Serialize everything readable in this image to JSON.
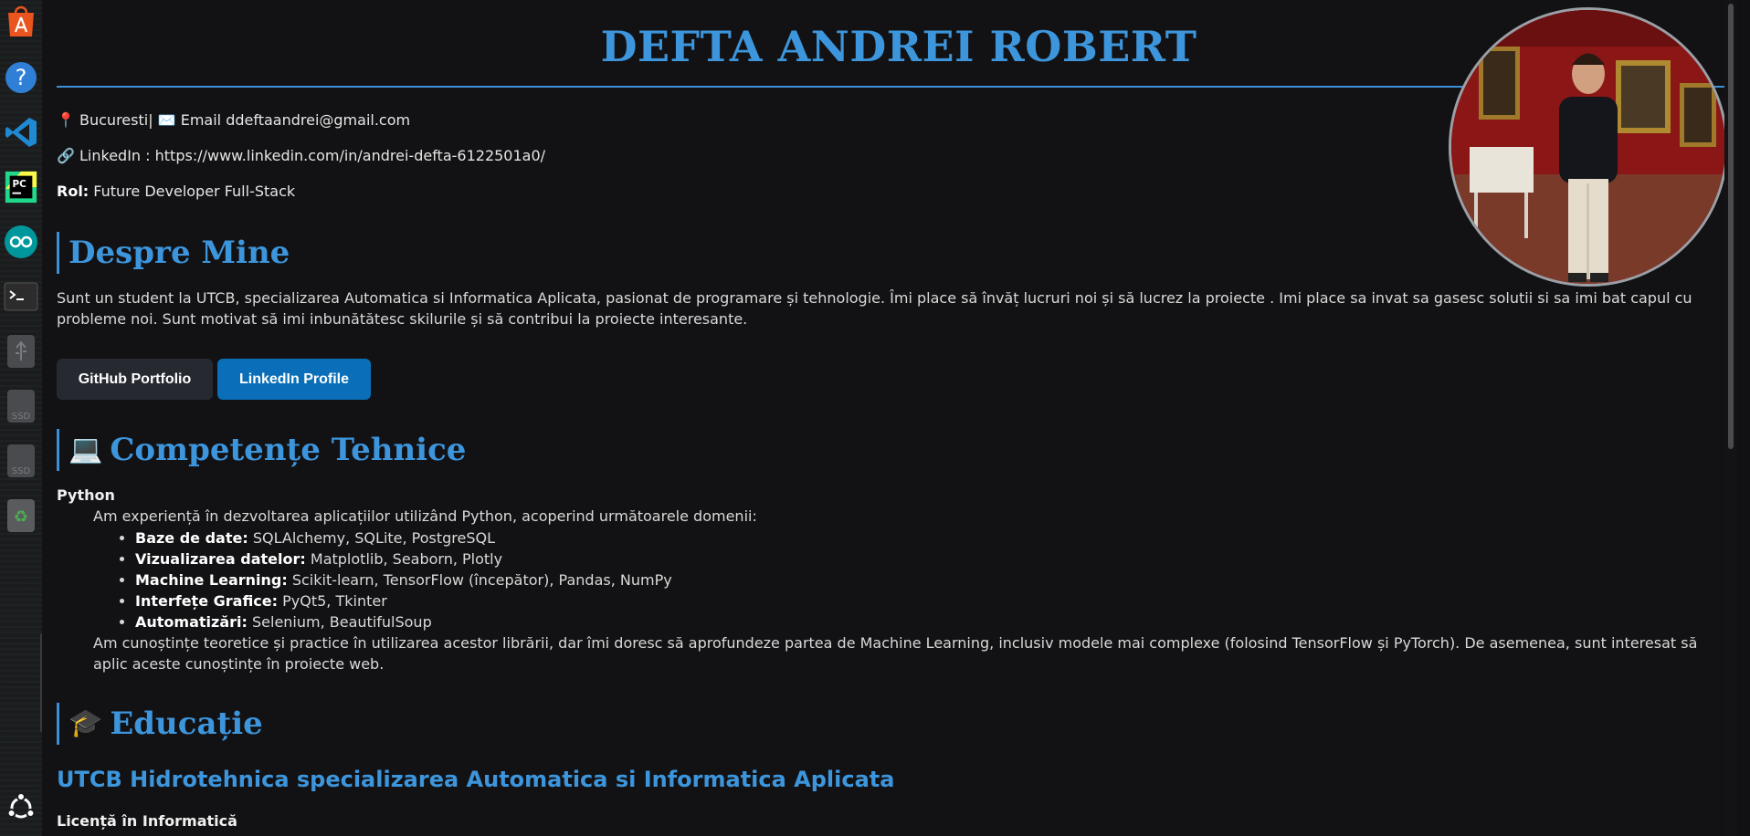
{
  "dock": {
    "items": [
      {
        "name": "app-store-icon"
      },
      {
        "name": "help-icon"
      },
      {
        "name": "vscode-icon"
      },
      {
        "name": "pycharm-icon"
      },
      {
        "name": "arduino-icon"
      },
      {
        "name": "terminal-icon"
      },
      {
        "name": "usb-drive-icon"
      },
      {
        "name": "ssd-drive-icon"
      },
      {
        "name": "ssd-drive-icon"
      },
      {
        "name": "trash-icon"
      },
      {
        "name": "ubuntu-apps-icon"
      }
    ],
    "ssd_label": "SSD",
    "pycharm_label": "PC"
  },
  "header": {
    "name": "DEFTA ANDREI ROBERT"
  },
  "contact": {
    "location_icon": "📍",
    "location": "Bucuresti",
    "separator": "|",
    "email_icon": "✉️",
    "email_label": "Email",
    "email": "ddeftaandrei@gmail.com",
    "link_icon": "🔗",
    "linkedin_label": "LinkedIn :",
    "linkedin_url": "https://www.linkedin.com/in/andrei-defta-6122501a0/",
    "role_label": "Rol:",
    "role": "Future Developer Full-Stack"
  },
  "about": {
    "heading": "Despre Mine",
    "text": "Sunt un student la UTCB, specializarea Automatica si Informatica Aplicata, pasionat de programare și tehnologie. Îmi place să învăț lucruri noi și să lucrez la proiecte . Imi place sa invat sa gasesc solutii si sa imi bat capul cu probleme noi. Sunt motivat să imi inbunătătesc skilurile și să contribui la proiecte interesante."
  },
  "buttons": {
    "github": "GitHub Portfolio",
    "linkedin": "LinkedIn Profile"
  },
  "skills": {
    "heading_icon": "💻",
    "heading": "Competențe Tehnice",
    "language": "Python",
    "intro": "Am experiență în dezvoltarea aplicațiilor utilizând Python, acoperind următoarele domenii:",
    "items": [
      {
        "label": "Baze de date:",
        "value": "SQLAlchemy, SQLite, PostgreSQL"
      },
      {
        "label": "Vizualizarea datelor:",
        "value": "Matplotlib, Seaborn, Plotly"
      },
      {
        "label": "Machine Learning:",
        "value": "Scikit-learn, TensorFlow (începător), Pandas, NumPy"
      },
      {
        "label": "Interfețe Grafice:",
        "value": "PyQt5, Tkinter"
      },
      {
        "label": "Automatizări:",
        "value": "Selenium, BeautifulSoup"
      }
    ],
    "outro": "Am cunoștințe teoretice și practice în utilizarea acestor librării, dar îmi doresc să aprofundeze partea de Machine Learning, inclusiv modele mai complexe (folosind TensorFlow și PyTorch). De asemenea, sunt interesat să aplic aceste cunoștințe în proiecte web."
  },
  "education": {
    "heading_icon": "🎓",
    "heading": "Educație",
    "school": "UTCB Hidrotehnica specializarea Automatica si Informatica Aplicata",
    "degree": "Licență în Informatică"
  },
  "colors": {
    "accent": "#3d95dc",
    "background": "#121214",
    "github_button": "#262a30",
    "linkedin_button": "#0a6fb8"
  }
}
